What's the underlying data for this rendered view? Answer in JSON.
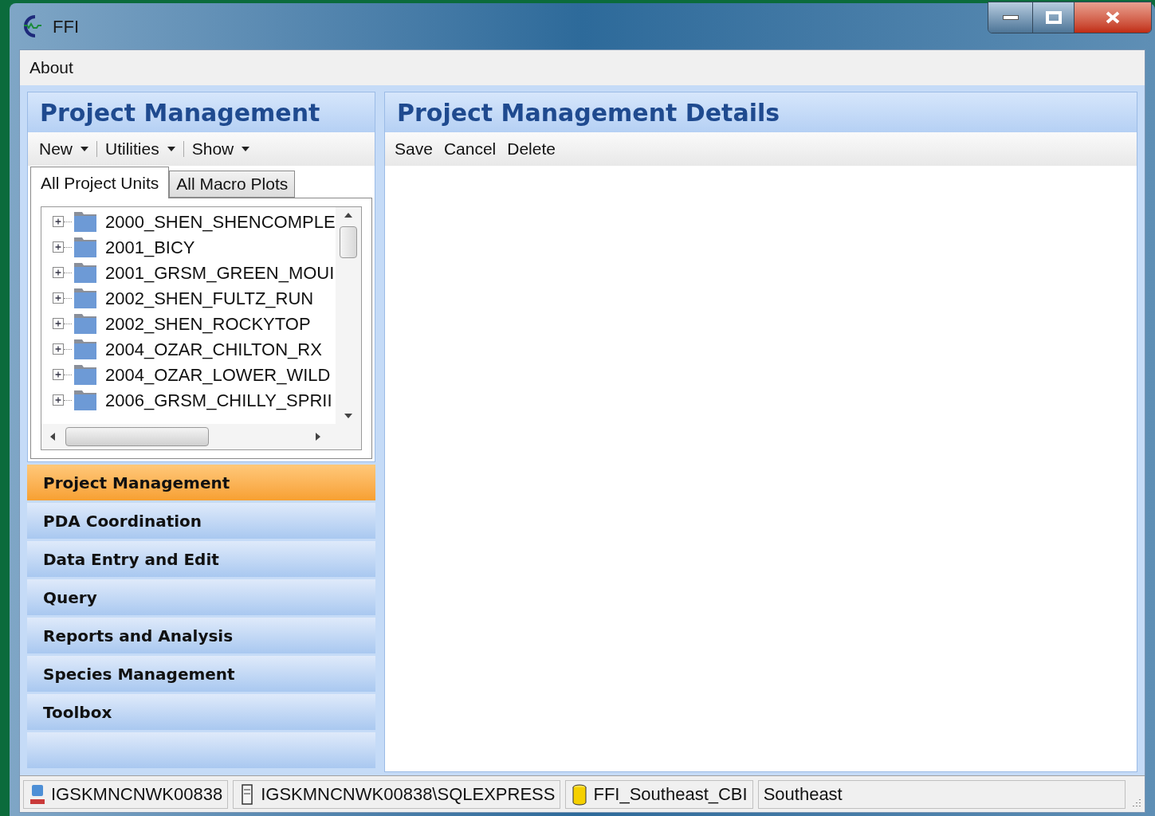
{
  "window": {
    "title": "FFI"
  },
  "menu": [
    "About"
  ],
  "left_panel": {
    "title": "Project Management",
    "toolbar": [
      {
        "label": "New",
        "dropdown": true
      },
      {
        "label": "Utilities",
        "dropdown": true
      },
      {
        "label": "Show",
        "dropdown": true
      }
    ],
    "tabs": [
      {
        "label": "All Project Units",
        "selected": true
      },
      {
        "label": "All Macro Plots",
        "selected": false
      }
    ],
    "tree": [
      {
        "label": "2000_SHEN_SHENCOMPLE",
        "expanded": false
      },
      {
        "label": "2001_BICY",
        "expanded": false
      },
      {
        "label": "2001_GRSM_GREEN_MOUI",
        "expanded": false
      },
      {
        "label": "2002_SHEN_FULTZ_RUN",
        "expanded": false
      },
      {
        "label": "2002_SHEN_ROCKYTOP",
        "expanded": false
      },
      {
        "label": "2004_OZAR_CHILTON_RX",
        "expanded": false
      },
      {
        "label": "2004_OZAR_LOWER_WILD",
        "expanded": false
      },
      {
        "label": "2006_GRSM_CHILLY_SPRII",
        "expanded": false
      }
    ]
  },
  "nav": [
    {
      "label": "Project Management",
      "selected": true
    },
    {
      "label": "PDA Coordination",
      "selected": false
    },
    {
      "label": "Data Entry and Edit",
      "selected": false
    },
    {
      "label": "Query",
      "selected": false
    },
    {
      "label": "Reports and Analysis",
      "selected": false
    },
    {
      "label": "Species Management",
      "selected": false
    },
    {
      "label": "Toolbox",
      "selected": false
    }
  ],
  "right_panel": {
    "title": "Project Management Details",
    "toolbar": [
      "Save",
      "Cancel",
      "Delete"
    ]
  },
  "status_bar": [
    {
      "kind": "computer",
      "text": "IGSKMNCNWK00838"
    },
    {
      "kind": "server",
      "text": "IGSKMNCNWK00838\\SQLEXPRESS"
    },
    {
      "kind": "database",
      "text": "FFI_Southeast_CBI"
    },
    {
      "kind": "plain",
      "text": "Southeast"
    }
  ]
}
